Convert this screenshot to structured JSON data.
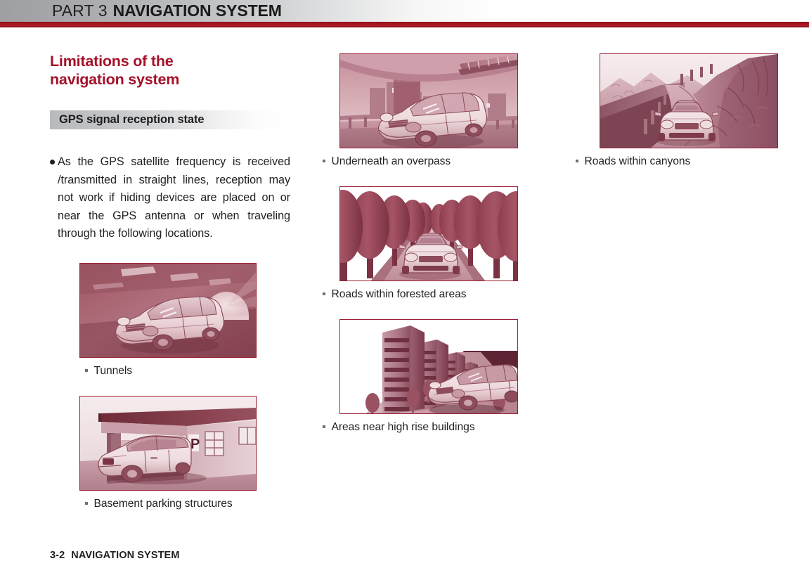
{
  "header": {
    "part_label": "PART 3",
    "part_title": "NAVIGATION SYSTEM",
    "rule_color": "#a81621"
  },
  "section": {
    "title_line1": "Limitations of the",
    "title_line2": "navigation system",
    "title_color": "#a5112a",
    "subsection_title": "GPS signal reception state"
  },
  "intro": {
    "bullet": "●",
    "text": "As the GPS satellite frequency is received /transmitted in straight lines, reception may not work if hiding devices are placed on or near the GPS antenna or when traveling through the following locations."
  },
  "figures": [
    {
      "id": "tunnels",
      "caption": "Tunnels",
      "scene": "tunnel-interior-with-car",
      "column": "left"
    },
    {
      "id": "basement",
      "caption": "Basement parking structures",
      "scene": "parking-structure-with-car",
      "column": "left"
    },
    {
      "id": "overpass",
      "caption": "Underneath an overpass",
      "scene": "overpass-with-car-and-city",
      "column": "middle"
    },
    {
      "id": "forest",
      "caption": "Roads within forested areas",
      "scene": "tree-lined-road-with-car",
      "column": "middle"
    },
    {
      "id": "highrise",
      "caption": "Areas near high rise buildings",
      "scene": "high-rise-buildings-with-car",
      "column": "middle"
    },
    {
      "id": "canyons",
      "caption": "Roads within canyons",
      "scene": "canyon-mountain-road-with-car",
      "column": "right"
    }
  ],
  "footer": {
    "page_number": "3-2",
    "label": "NAVIGATION SYSTEM"
  },
  "palette": {
    "brand_red": "#a5112a",
    "rule_red": "#a81621",
    "figure_border": "#9b2034",
    "illustration_dark": "#7c3444",
    "illustration_mid": "#b0717f",
    "illustration_light": "#e4c3c8",
    "text": "#231f20"
  }
}
